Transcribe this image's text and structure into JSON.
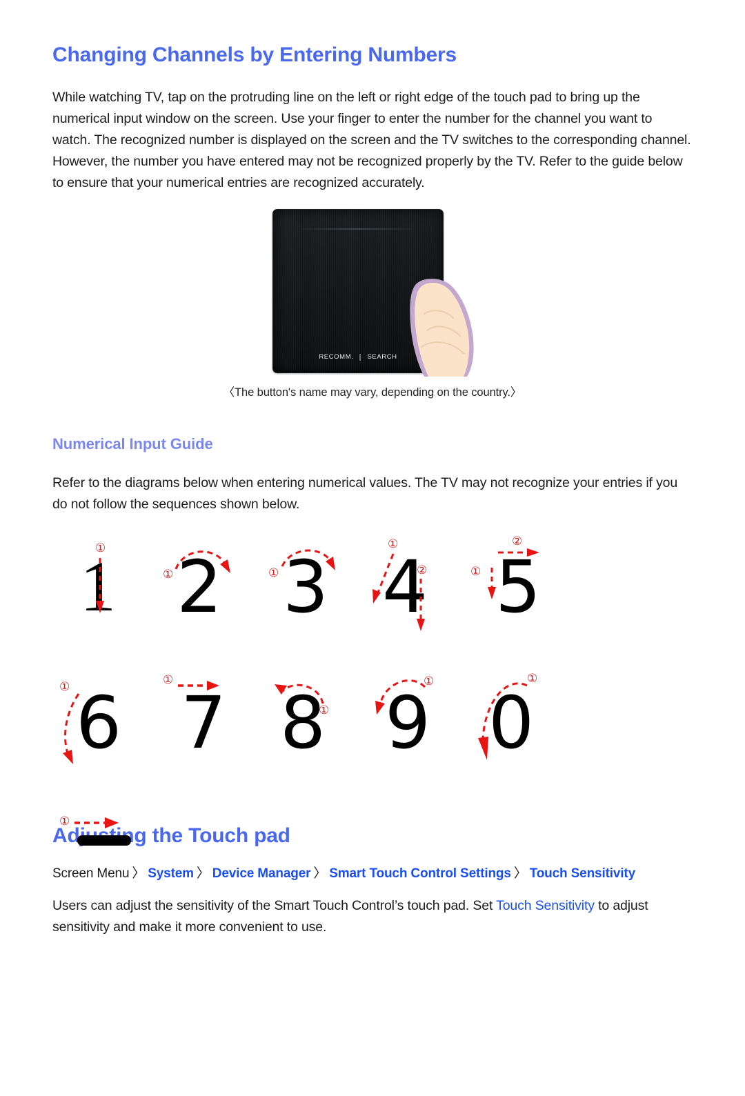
{
  "page": {
    "title": "Changing Channels by Entering Numbers",
    "intro_paragraph": "While watching TV, tap on the protruding line on the left or right edge of the touch pad to bring up the numerical input window on the screen. Use your finger to enter the number for the channel you want to watch. The recognized number is displayed on the screen and the TV switches to the corresponding channel. However, the number you have entered may not be recognized properly by the TV. Refer to the guide below to ensure that your numerical entries are recognized accurately."
  },
  "figure": {
    "pad_label_left": "RECOMM.",
    "pad_label_right": "SEARCH",
    "caption": "〈The button's name may vary, depending on the country.〉"
  },
  "numerical_guide": {
    "heading": "Numerical Input Guide",
    "paragraph": "Refer to the diagrams below when entering numerical values. The TV may not recognize your entries if you do not follow the sequences shown below.",
    "digits": [
      {
        "glyph": "1",
        "strokes": [
          "①"
        ]
      },
      {
        "glyph": "2",
        "strokes": [
          "①"
        ]
      },
      {
        "glyph": "3",
        "strokes": [
          "①"
        ]
      },
      {
        "glyph": "4",
        "strokes": [
          "①",
          "②"
        ]
      },
      {
        "glyph": "5",
        "strokes": [
          "①",
          "②"
        ]
      },
      {
        "glyph": "6",
        "strokes": [
          "①"
        ]
      },
      {
        "glyph": "7",
        "strokes": [
          "①"
        ]
      },
      {
        "glyph": "8",
        "strokes": [
          "①"
        ]
      },
      {
        "glyph": "9",
        "strokes": [
          "①"
        ]
      },
      {
        "glyph": "0",
        "strokes": [
          "①"
        ]
      },
      {
        "glyph": "-",
        "strokes": [
          "①"
        ]
      }
    ]
  },
  "touchpad_section": {
    "title": "Adjusting the Touch pad",
    "breadcrumb": {
      "root": "Screen Menu",
      "separator": "〉",
      "items": [
        "System",
        "Device Manager",
        "Smart Touch Control Settings",
        "Touch Sensitivity"
      ]
    },
    "paragraph_part1": "Users can adjust the sensitivity of the Smart Touch Control’s touch pad. Set ",
    "paragraph_link": "Touch Sensitivity",
    "paragraph_part2": " to adjust sensitivity and make it more convenient to use."
  },
  "colors": {
    "heading_blue": "#4a68ee",
    "subheading_blue": "#7b87f0",
    "link_blue": "#1a4ef0",
    "stroke_red": "#e81414",
    "pad_black": "#15191b",
    "finger_fill": "#fbe3c9",
    "finger_outline": "#c3a7cf",
    "dot_blue": "#1b6ed2"
  }
}
